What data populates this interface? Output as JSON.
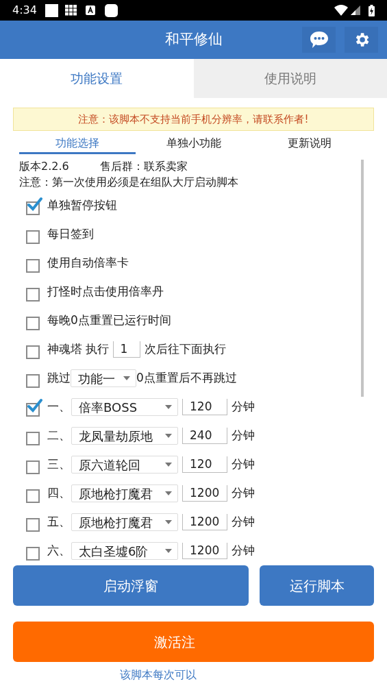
{
  "status_bar": {
    "time": "4:34"
  },
  "header": {
    "title": "和平修仙"
  },
  "tabs": [
    {
      "label": "功能设置",
      "selected": true
    },
    {
      "label": "使用说明",
      "selected": false
    }
  ],
  "notice": "注意：该脚本不支持当前手机分辨率，请联系作者!",
  "sub_tabs": [
    {
      "label": "功能选择",
      "selected": true
    },
    {
      "label": "单独小功能",
      "selected": false
    },
    {
      "label": "更新说明",
      "selected": false
    }
  ],
  "info": {
    "version": "版本2.2.6",
    "group": "售后群：联系卖家",
    "note": "注意：第一次使用必须是在组队大厅启动脚本"
  },
  "options": [
    {
      "kind": "plain",
      "label": "单独暂停按钮",
      "checked": true
    },
    {
      "kind": "plain",
      "label": "每日签到",
      "checked": false
    },
    {
      "kind": "plain",
      "label": "使用自动倍率卡",
      "checked": false
    },
    {
      "kind": "plain",
      "label": "打怪时点击使用倍率丹",
      "checked": false
    },
    {
      "kind": "plain",
      "label": "每晚0点重置已运行时间",
      "checked": false
    },
    {
      "kind": "counter",
      "label": "神魂塔 执行",
      "value": "1",
      "suffix": "次后往下面执行",
      "checked": false
    },
    {
      "kind": "skip",
      "label": "跳过",
      "select": "功能一",
      "suffix": "0点重置后不再跳过",
      "checked": false
    },
    {
      "kind": "task",
      "label": "一、",
      "select": "倍率BOSS",
      "value": "120",
      "unit": "分钟",
      "checked": true
    },
    {
      "kind": "task",
      "label": "二、",
      "select": "龙凤量劫原地",
      "value": "240",
      "unit": "分钟",
      "checked": false
    },
    {
      "kind": "task",
      "label": "三、",
      "select": "原六道轮回",
      "value": "120",
      "unit": "分钟",
      "checked": false
    },
    {
      "kind": "task",
      "label": "四、",
      "select": "原地枪打魔君",
      "value": "1200",
      "unit": "分钟",
      "checked": false
    },
    {
      "kind": "task",
      "label": "五、",
      "select": "原地枪打魔君",
      "value": "1200",
      "unit": "分钟",
      "checked": false
    },
    {
      "kind": "task",
      "label": "六、",
      "select": "太白圣墟6阶",
      "value": "1200",
      "unit": "分钟",
      "checked": false
    }
  ],
  "buttons": {
    "float": "启动浮窗",
    "run": "运行脚本",
    "activate": "激活注"
  },
  "footer_note": "该脚本每次可以"
}
